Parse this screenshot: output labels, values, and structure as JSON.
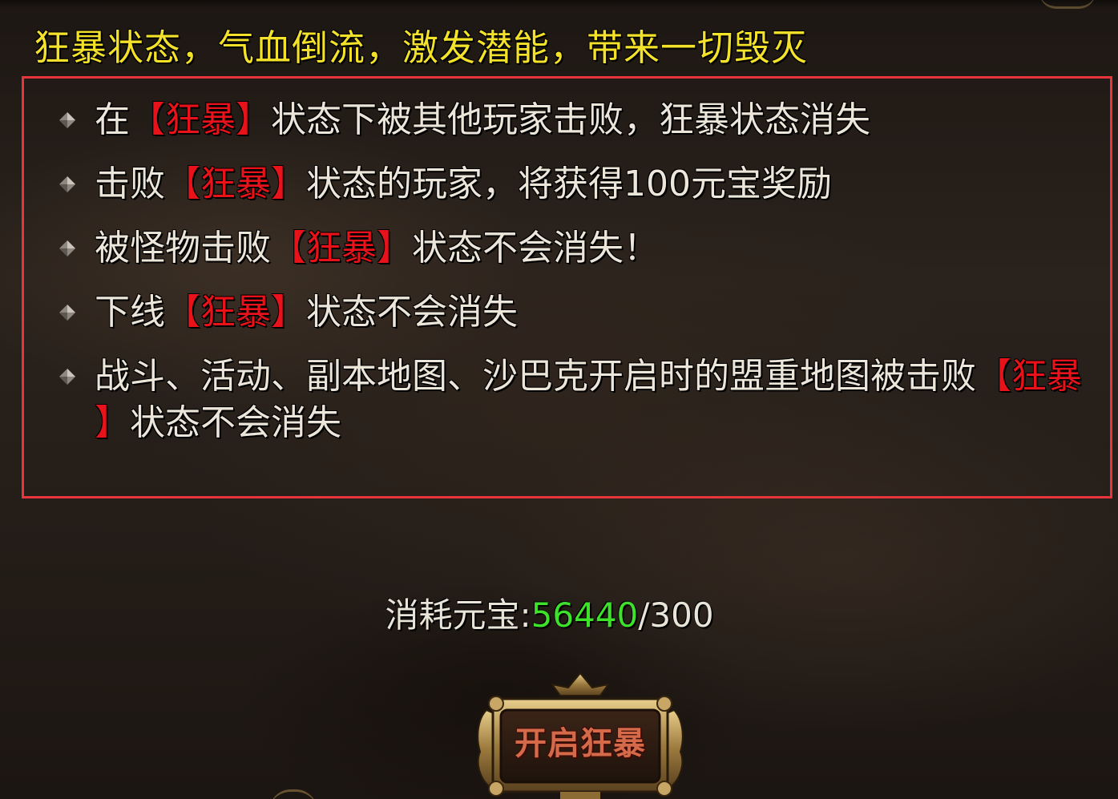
{
  "headline": "狂暴状态，气血倒流，激发潜能，带来一切毁灭",
  "keyword": "【狂暴】",
  "keyword_open": "【狂暴",
  "keyword_close": "】",
  "rules": [
    {
      "before": "在",
      "after": "状态下被其他玩家击败，狂暴状态消失"
    },
    {
      "before": "击败",
      "after": "状态的玩家，将获得100元宝奖励"
    },
    {
      "before": "被怪物击败",
      "after": "状态不会消失！"
    },
    {
      "before": "下线",
      "after": "状态不会消失"
    },
    {
      "before": "战斗、活动、副本地图、沙巴克开启时的盟重地图被击败",
      "after": "状态不会消失"
    }
  ],
  "cost": {
    "label": "消耗元宝:",
    "current": "56440",
    "separator": "/",
    "required": "300"
  },
  "action_button": {
    "label": "开启狂暴"
  },
  "colors": {
    "headline": "#f3e12a",
    "keyword": "#e8121a",
    "current_amount": "#3fe22a",
    "highlight_border": "#e8343b"
  },
  "icons": {
    "bullet": "diamond-bullet-icon"
  }
}
